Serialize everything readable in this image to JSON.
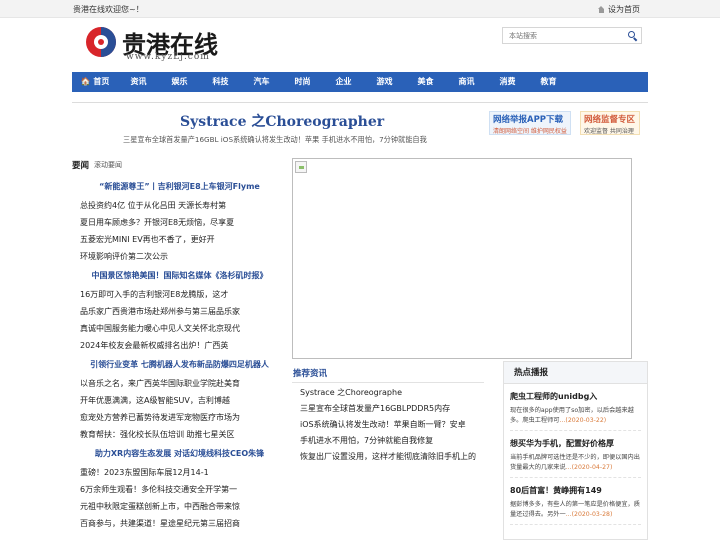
{
  "topbar": {
    "welcome": "贵港在线欢迎您~！",
    "home_label": "设为首页"
  },
  "logo": {
    "name": "贵港在线",
    "domain": "www.kyzLj.com",
    "colors": {
      "red": "#d8252a",
      "blue": "#2a4e96"
    }
  },
  "search": {
    "placeholder": "本站搜索"
  },
  "nav": {
    "color": "#2a61b8",
    "items": [
      {
        "label": "🏠 首页"
      },
      {
        "label": "资讯"
      },
      {
        "label": "娱乐"
      },
      {
        "label": "科技"
      },
      {
        "label": "汽车"
      },
      {
        "label": "时尚"
      },
      {
        "label": "企业"
      },
      {
        "label": "游戏"
      },
      {
        "label": "美食"
      },
      {
        "label": "商讯"
      },
      {
        "label": "消费"
      },
      {
        "label": "教育"
      }
    ]
  },
  "headline": {
    "title": "Systrace 之Choreographer",
    "subtitle": "三星宣布全球首发量产16GBL  iOS系统确认将发生改动！苹果  手机进水不用怕，7分钟就能自我"
  },
  "ads": [
    {
      "title": "网络举报APP下载",
      "sub": "清朗网络空间 维护网民权益"
    },
    {
      "title": "网络监督专区",
      "sub": "欢迎监督 共同治理"
    }
  ],
  "news_section": {
    "title": "要闻",
    "sub": "滚动要闻",
    "groups": [
      {
        "feature": "“新能源尊王”丨吉利银河E8上车银河Flyme",
        "lines": [
          "总投资约4亿 位于从化吕田 天源长寿村第",
          "夏日用车顾虑多？开银河E8无烦恼，尽享夏",
          "五菱宏光MINI EV再也不香了，更好开",
          "环境影响评价第二次公示"
        ]
      },
      {
        "feature": "中国景区惊艳美国！国际知名媒体《洛杉矶时报》",
        "lines": [
          "16万即可入手的吉利银河E8龙腾版，这才",
          "品乐家广西贵港市场赴郑州参与第三届品乐家",
          "真诚中国服务能力暖心中见人文关怀北京现代",
          "2024年校友会最新权威排名出炉！广西英"
        ]
      },
      {
        "feature": "引领行业变革 七腾机器人发布新品防爆四足机器人",
        "lines": [
          "以音乐之名，来广西英华国际职业学院赴美育",
          "开年优惠满满，这A级智能SUV，吉利博越",
          "愈宠处方营养已蓄势待发进军宠物医疗市场为",
          "教育帮扶：强化校长队伍培训 助推七星关区"
        ]
      },
      {
        "feature": "助力XR内容生态发展 对话幻境线科技CEO朱锋",
        "lines": [
          "重磅！2023东盟国际车展12月14-1",
          "6万余师生观看！多伦科技交通安全开学第一",
          "元祖中秋限定蛋糕创新上市，中西融合带来惊",
          "百商参与，共建渠道！星途星纪元第三届招商"
        ]
      }
    ]
  },
  "recommend": {
    "title": "推荐资讯",
    "items": [
      "Systrace 之Choreographe",
      "三星宣布全球首发量产16GBLPDDR5内存",
      "iOS系统确认将发生改动！苹果自断一臂？安卓",
      "手机进水不用怕，7分钟就能自我修复",
      "恢复出厂设置没用，这样才能彻底清除旧手机上的"
    ]
  },
  "hot": {
    "title": "热点播报",
    "items": [
      {
        "title": "爬虫工程师的unidbg入",
        "desc": "现在很多的app使用了so加密，以后会越来越多。爬虫工程师可",
        "date": "...(2020-03-22)"
      },
      {
        "title": "想买华为手机，配置好价格厚",
        "desc": "当前手机品牌可选性还是不少的，即便以国内出货量最大的几家来说",
        "date": "...(2020-04-27)"
      },
      {
        "title": "80后首富！黄峥拥有149",
        "desc": "据彭博多多，有些人的第一笔应是价格便宜，质量还过得去。另外一",
        "date": "...(2020-03-28)"
      }
    ]
  }
}
